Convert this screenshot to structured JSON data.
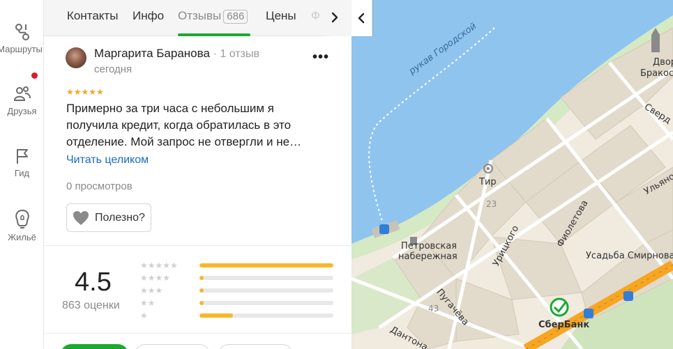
{
  "sidebar": {
    "items": [
      {
        "label": "Маршруты",
        "icon": "routes-icon"
      },
      {
        "label": "Друзья",
        "icon": "friends-icon",
        "notification": true
      },
      {
        "label": "Гид",
        "icon": "guide-flag-icon"
      },
      {
        "label": "Жильё",
        "icon": "housing-icon"
      }
    ]
  },
  "tabs": {
    "items": [
      {
        "label": "Контакты"
      },
      {
        "label": "Инфо"
      },
      {
        "label": "Отзывы",
        "badge": "686",
        "active": true
      },
      {
        "label": "Цены"
      },
      {
        "label": "Ф"
      }
    ],
    "scroll_right_icon": "chevron-right-icon"
  },
  "review": {
    "author": "Маргарита Баранова",
    "author_meta": "· 1 отзыв",
    "date": "сегодня",
    "stars": "★★★★★",
    "text": "Примерно за три часа с небольшим я получила кредит, когда обратилась в это отделение. Мой запрос не отвергли и не…",
    "read_more": "Читать целиком",
    "views": "0 просмотров",
    "useful_label": "Полезно?",
    "menu_label": "•••"
  },
  "rating": {
    "score": "4.5",
    "count_label": "863 оценки",
    "distribution": [
      {
        "stars": "★★★★★",
        "fraction": 1.0
      },
      {
        "stars": "★★★★",
        "fraction": 0.03
      },
      {
        "stars": "★★★",
        "fraction": 0.03
      },
      {
        "stars": "★★",
        "fraction": 0.03
      },
      {
        "stars": "★",
        "fraction": 0.25
      }
    ]
  },
  "map": {
    "labels": {
      "river": "рукав Городской",
      "tir": "Тир",
      "petrovskaya1": "Петровская",
      "petrovskaya2": "набережная",
      "uritskogo": "Урицкого",
      "fioletova": "Фиолетова",
      "pugacheva": "Пугачёва",
      "dantona": "Дантона",
      "sverdlova": "Сверд",
      "ulyanovykh": "Ульяновых",
      "usadba": "Усадьба Смирнова",
      "dvor": "Двор",
      "brakosoch": "Бракосоч",
      "sberbank": "СберБанк",
      "num23": "23",
      "num43": "43"
    },
    "colors": {
      "water": "#8fc4ef",
      "land": "#f0eadf",
      "park": "#d4e9c4",
      "road_main": "#f6a623",
      "brand": "#1ba92f"
    }
  },
  "colors": {
    "accent": "#1ba92f",
    "link": "#1a6ac2",
    "star": "#f5a623",
    "bar": "#fbb62a"
  }
}
